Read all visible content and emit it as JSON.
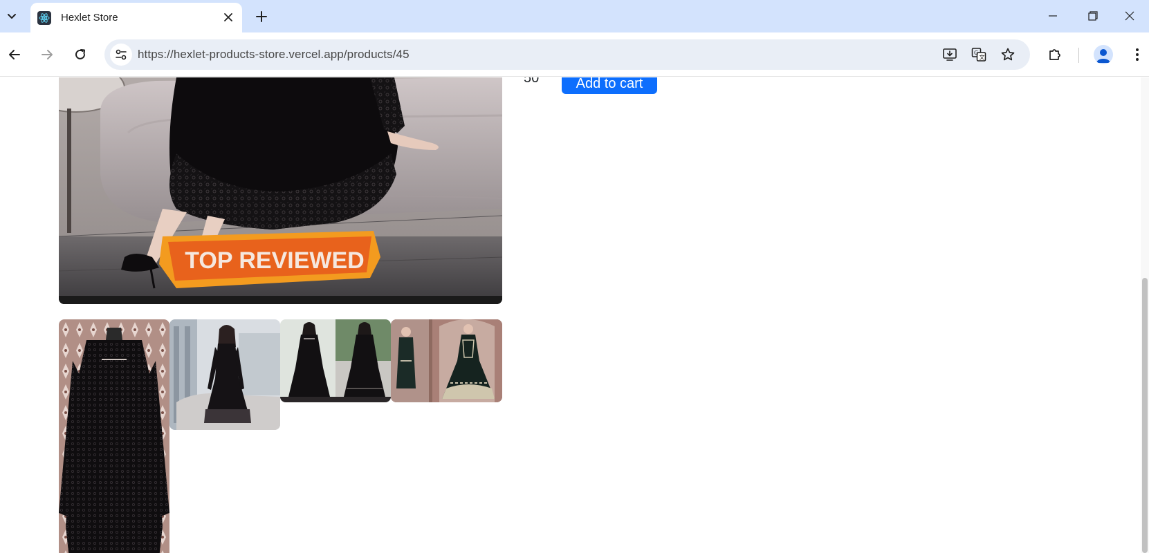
{
  "browser": {
    "tab": {
      "title": "Hexlet Store"
    },
    "address_bar": {
      "url": "https://hexlet-products-store.vercel.app/products/45"
    }
  },
  "product": {
    "banner_text": "TOP REVIEWED",
    "quantity": "50",
    "add_to_cart_label": "Add to cart",
    "add_to_cart_color": "#0d6efd",
    "gallery_thumbnails": [
      {
        "name": "thumbnail-1"
      },
      {
        "name": "thumbnail-2"
      },
      {
        "name": "thumbnail-3"
      },
      {
        "name": "thumbnail-4"
      }
    ]
  }
}
